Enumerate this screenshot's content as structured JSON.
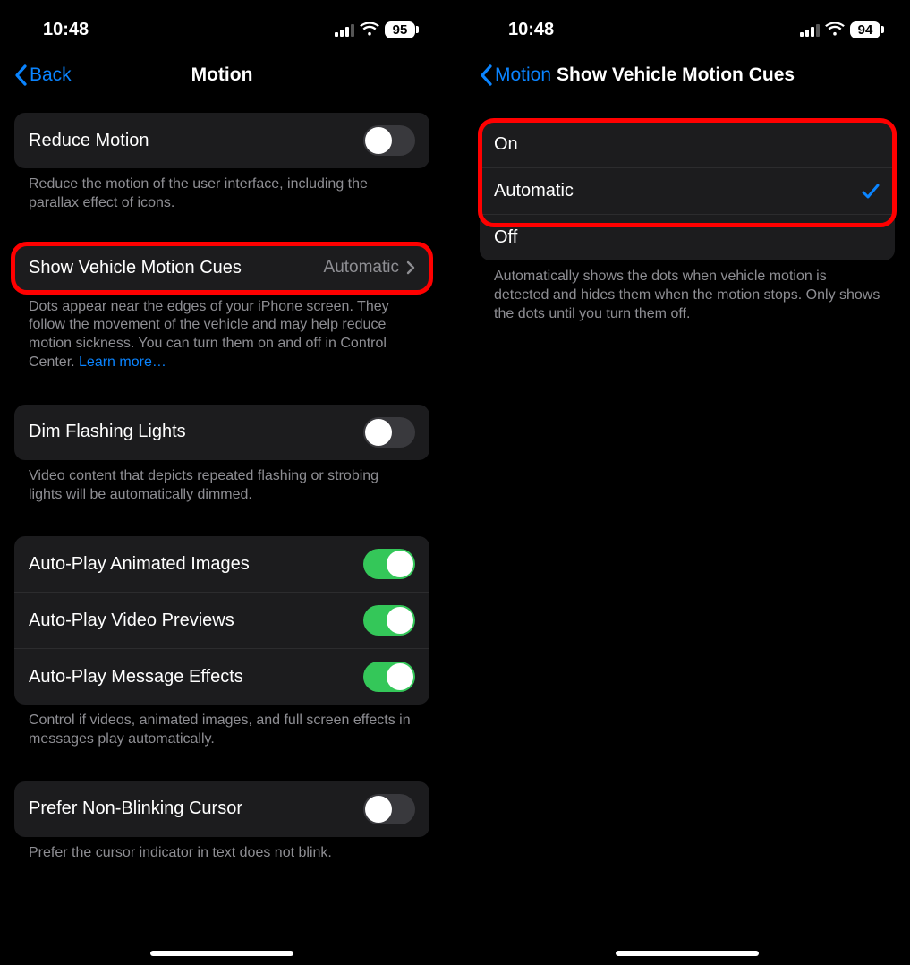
{
  "left": {
    "status": {
      "time": "10:48",
      "battery": "95"
    },
    "nav": {
      "back": "Back",
      "title": "Motion"
    },
    "reduceMotion": {
      "label": "Reduce Motion",
      "footer": "Reduce the motion of the user interface, including the parallax effect of icons."
    },
    "vehicleCues": {
      "label": "Show Vehicle Motion Cues",
      "value": "Automatic",
      "footer": "Dots appear near the edges of your iPhone screen. They follow the movement of the vehicle and may help reduce motion sickness. You can turn them on and off in Control Center. ",
      "learnMore": "Learn more…"
    },
    "dimFlashing": {
      "label": "Dim Flashing Lights",
      "footer": "Video content that depicts repeated flashing or strobing lights will be automatically dimmed."
    },
    "autoplay": {
      "images": "Auto-Play Animated Images",
      "videos": "Auto-Play Video Previews",
      "effects": "Auto-Play Message Effects",
      "footer": "Control if videos, animated images, and full screen effects in messages play automatically."
    },
    "cursor": {
      "label": "Prefer Non-Blinking Cursor",
      "footer": "Prefer the cursor indicator in text does not blink."
    }
  },
  "right": {
    "status": {
      "time": "10:48",
      "battery": "94"
    },
    "nav": {
      "back": "Motion",
      "title": "Show Vehicle Motion Cues"
    },
    "options": {
      "on": "On",
      "automatic": "Automatic",
      "off": "Off"
    },
    "footer": "Automatically shows the dots when vehicle motion is detected and hides them when the motion stops. Only shows the dots until you turn them off."
  }
}
